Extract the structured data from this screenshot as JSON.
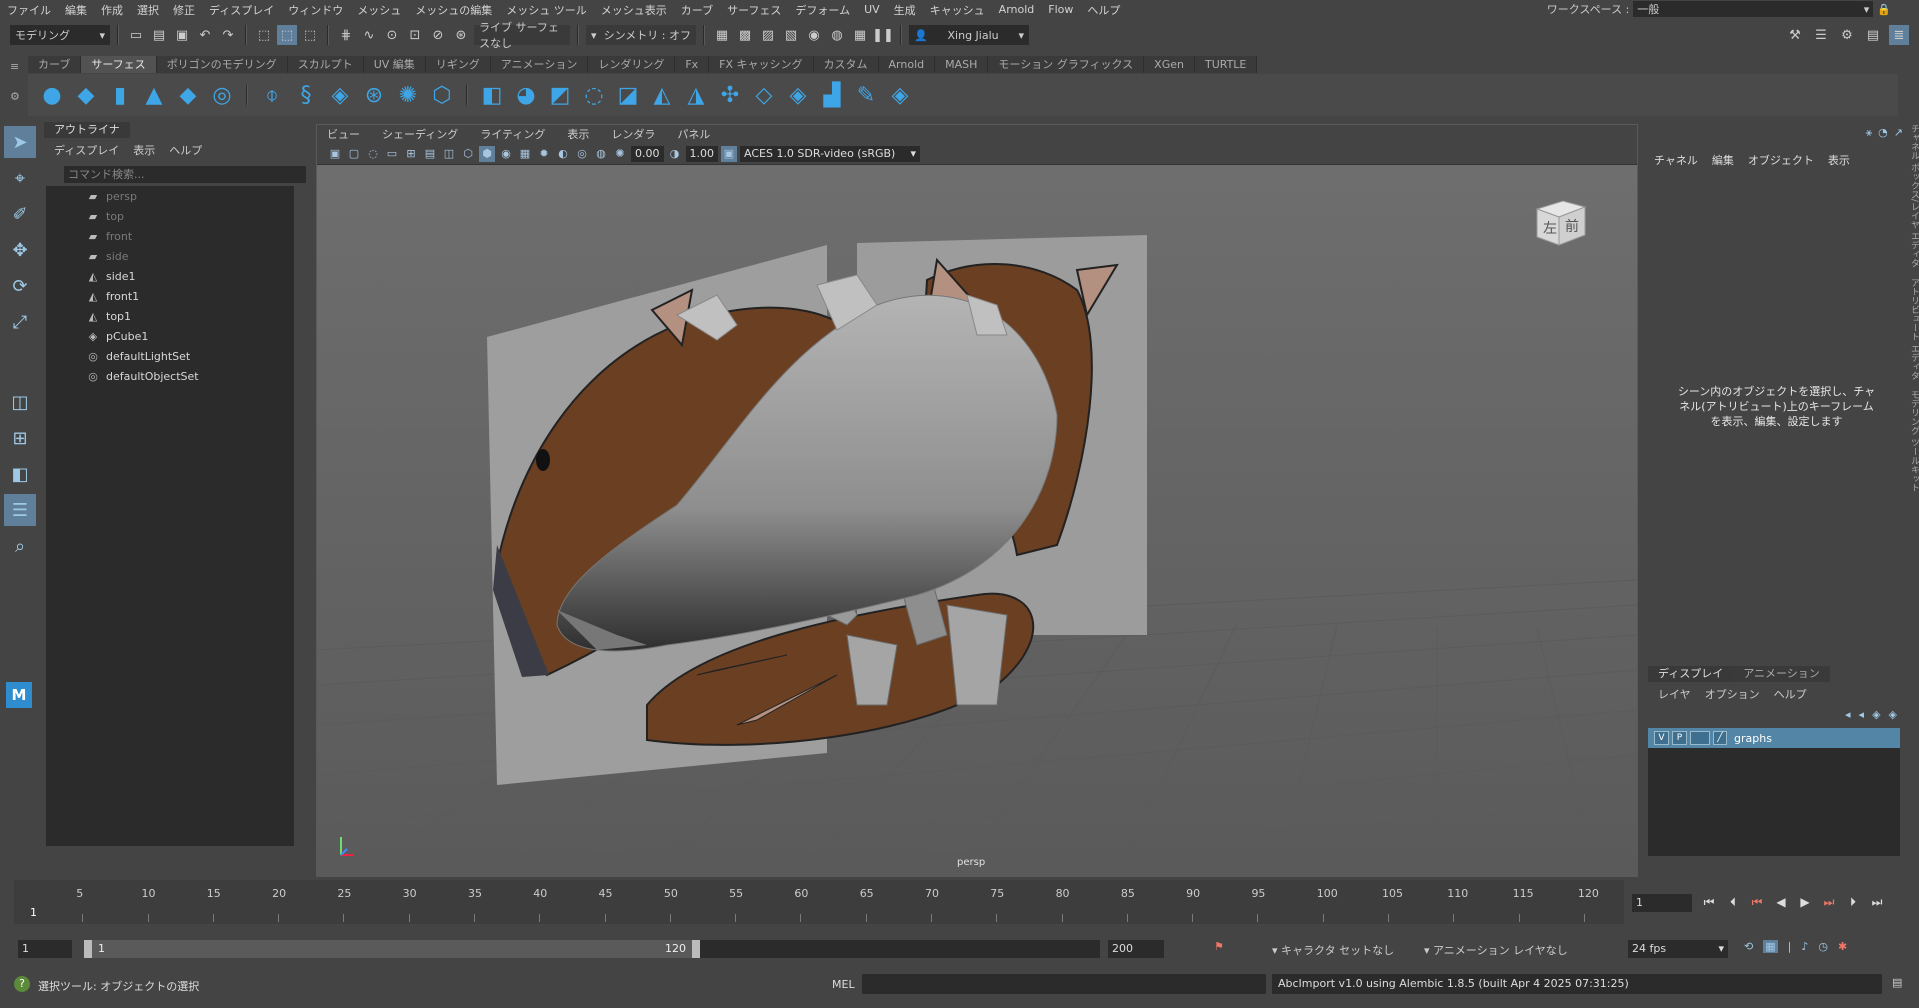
{
  "menubar": {
    "items": [
      "ファイル",
      "編集",
      "作成",
      "選択",
      "修正",
      "ディスプレイ",
      "ウィンドウ",
      "メッシュ",
      "メッシュの編集",
      "メッシュ ツール",
      "メッシュ表示",
      "カーブ",
      "サーフェス",
      "デフォーム",
      "UV",
      "生成",
      "キャッシュ",
      "Arnold",
      "Flow",
      "ヘルプ"
    ],
    "workspace_label": "ワークスペース :",
    "workspace_value": "一般"
  },
  "statusline": {
    "mode": "モデリング",
    "live_surface": "ライブ サーフェスなし",
    "symmetry": "シンメトリ : オフ",
    "user": "Xing Jialu"
  },
  "shelf": {
    "tabs": [
      "カーブ",
      "サーフェス",
      "ポリゴンのモデリング",
      "スカルプト",
      "UV 編集",
      "リギング",
      "アニメーション",
      "レンダリング",
      "Fx",
      "FX キャッシング",
      "カスタム",
      "Arnold",
      "MASH",
      "モーション グラフィックス",
      "XGen",
      "TURTLE"
    ],
    "active_tab": 1
  },
  "outliner": {
    "title": "アウトライナ",
    "menus": [
      "ディスプレイ",
      "表示",
      "ヘルプ"
    ],
    "search_placeholder": "コマンド検索...",
    "items": [
      {
        "label": "persp",
        "icon": "camera-icon",
        "dim": true
      },
      {
        "label": "top",
        "icon": "camera-icon",
        "dim": true
      },
      {
        "label": "front",
        "icon": "camera-icon",
        "dim": true
      },
      {
        "label": "side",
        "icon": "camera-icon",
        "dim": true
      },
      {
        "label": "side1",
        "icon": "image-plane-icon",
        "dim": false
      },
      {
        "label": "front1",
        "icon": "image-plane-icon",
        "dim": false
      },
      {
        "label": "top1",
        "icon": "image-plane-icon",
        "dim": false
      },
      {
        "label": "pCube1",
        "icon": "mesh-icon",
        "dim": false
      },
      {
        "label": "defaultLightSet",
        "icon": "set-icon",
        "dim": false
      },
      {
        "label": "defaultObjectSet",
        "icon": "set-icon",
        "dim": false
      }
    ]
  },
  "viewport": {
    "menus": [
      "ビュー",
      "シェーディング",
      "ライティング",
      "表示",
      "レンダラ",
      "パネル"
    ],
    "exposure": "0.00",
    "gamma": "1.00",
    "color_space": "ACES 1.0 SDR-video (sRGB)",
    "camera_label": "persp",
    "viewcube_left": "左",
    "viewcube_front": "前"
  },
  "channelbox": {
    "menus": [
      "チャネル",
      "編集",
      "オブジェクト",
      "表示"
    ],
    "message": "シーン内のオブジェクトを選択し、チャネル(アトリビュート)上のキーフレームを表示、編集、設定します"
  },
  "side_tabs": [
    "チャネル ボックス/レイヤ エディタ",
    "アトリビュート エディタ",
    "モデリング ツールキット"
  ],
  "layers": {
    "tabs": [
      "ディスプレイ",
      "アニメーション"
    ],
    "menus": [
      "レイヤ",
      "オプション",
      "ヘルプ"
    ],
    "layer": {
      "v": "V",
      "p": "P",
      "name": "graphs"
    }
  },
  "timeline": {
    "ticks": [
      5,
      10,
      15,
      20,
      25,
      30,
      35,
      40,
      45,
      50,
      55,
      60,
      65,
      70,
      75,
      80,
      85,
      90,
      95,
      100,
      105,
      110,
      115,
      120
    ],
    "current_frame": "1",
    "frame_field": "1"
  },
  "range": {
    "start": "1",
    "inner_start": "1",
    "inner_end": "120",
    "end": "200",
    "character_set": "キャラクタ セットなし",
    "anim_layer": "アニメーション レイヤなし",
    "fps": "24 fps"
  },
  "commandline": {
    "help": "選択ツール: オブジェクトの選択",
    "mel_label": "MEL",
    "result": "AbcImport v1.0 using Alembic 1.8.5 (built Apr  4 2025 07:31:25)"
  },
  "colors": {
    "accent": "#5285a6",
    "boar_brown": "#6b3f22",
    "mesh_grey": "#9a9a9a"
  }
}
